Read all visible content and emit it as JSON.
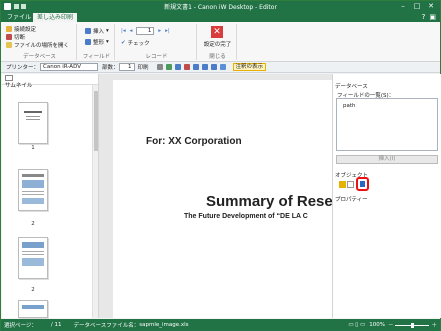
{
  "window": {
    "title": "新規文書1 - Canon iW Desktop - Editor"
  },
  "tabs": [
    {
      "label": "ファイル"
    },
    {
      "label": "差し込み印刷"
    }
  ],
  "ribbon": {
    "db_group": {
      "label": "データベース",
      "items": [
        "接続設定",
        "切断",
        "ファイルの場所を開く"
      ]
    },
    "field_group": {
      "label": "フィールド",
      "items": [
        "挿入",
        "整形"
      ]
    },
    "record_group": {
      "label": "レコード",
      "record_value": "1",
      "check_label": "チェック"
    },
    "finish_group": {
      "label": "閉じる",
      "finish_label": "設定の完了"
    }
  },
  "toolbar": {
    "printer_label": "プリンター：",
    "printer_value": "Canon iR-ADV",
    "copies_label": "部数：",
    "copies_value": "1",
    "print_label": "印刷",
    "comment_label": "注釈の表示"
  },
  "left_pane": {
    "tab_label": "サムネイル",
    "page_labels": [
      "1",
      "2",
      "2",
      "3"
    ]
  },
  "document": {
    "heading": "For: XX Corporation",
    "title": "Summary of Rese",
    "subtitle": "The Future Development of “DE LA C"
  },
  "right_pane": {
    "title": "データベース",
    "field_list_label": "フィールドの一覧(S)：",
    "field_items": [
      "path"
    ],
    "insert_button": "挿入(I)",
    "object_label": "オブジェクト",
    "property_label": "プロパティー"
  },
  "status": {
    "page_label": "選択ページ：",
    "page_value": "/ 11",
    "db_label": "データベースファイル名：",
    "db_value": "sapmle_image.xls",
    "zoom": "100%"
  }
}
